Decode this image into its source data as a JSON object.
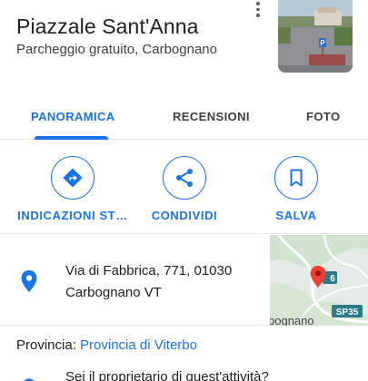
{
  "place": {
    "title": "Piazzale Sant'Anna",
    "subtitle": "Parcheggio gratuito, Carbognano"
  },
  "tabs": [
    {
      "label": "PANORAMICA",
      "active": true
    },
    {
      "label": "RECENSIONI",
      "active": false
    },
    {
      "label": "FOTO",
      "active": false
    }
  ],
  "actions": [
    {
      "label": "INDICAZIONI ST…",
      "icon": "directions-icon"
    },
    {
      "label": "CONDIVIDI",
      "icon": "share-icon"
    },
    {
      "label": "SALVA",
      "icon": "bookmark-icon"
    }
  ],
  "address": {
    "line1": "Via di Fabbrica, 771, 01030",
    "line2": "Carbognano VT",
    "icon": "location-pin-icon"
  },
  "map_preview": {
    "town_label": "bognano",
    "road_label": "SP35",
    "road_label_2": "6",
    "pin_color": "#ea4335"
  },
  "provincia": {
    "prefix": "Provincia:",
    "link": "Provincia di Viterbo"
  },
  "owner": {
    "text": "Sei il proprietario di quest'attività?"
  },
  "colors": {
    "accent": "#1a73e8",
    "text": "#202124",
    "divider": "#e8eaed"
  }
}
